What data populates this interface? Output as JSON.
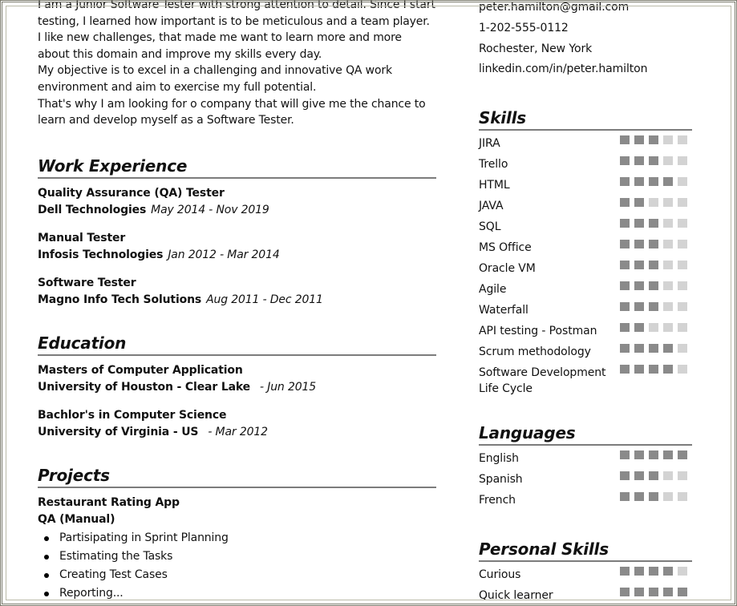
{
  "colors": {
    "filled": "#8a8a8a",
    "empty": "#d3d3d3",
    "rule": "#7c7c7c",
    "frame": "#7a7a6c"
  },
  "summary": [
    "I am a Junior Software Tester with strong attention to detail. Since I start testing, I learned how important is to be meticulous and a team player. I like new challenges, that made me want to learn more and more about this domain and improve my skills every day.",
    "My objective is to excel in a challenging and innovative QA work environment and aim to exercise my full potential.",
    "That's why I am looking for o company that will give me the chance to learn and develop myself as a Software Tester."
  ],
  "work": {
    "title": "Work Experience",
    "items": [
      {
        "role": "Quality Assurance (QA) Tester",
        "company": "Dell Technologies",
        "dates": "May 2014 - Nov 2019"
      },
      {
        "role": "Manual Tester",
        "company": "Infosis Technologies",
        "dates": "Jan 2012 - Mar 2014"
      },
      {
        "role": "Software Tester",
        "company": "Magno Info Tech Solutions",
        "dates": "Aug 2011 - Dec 2011"
      }
    ]
  },
  "education": {
    "title": "Education",
    "items": [
      {
        "degree": "Masters of Computer Application",
        "school": "University of Houston - Clear Lake",
        "dates": "- Jun 2015"
      },
      {
        "degree": "Bachlor's in Computer Science",
        "school": "University of Virginia - US",
        "dates": "- Mar 2012"
      }
    ]
  },
  "projects": {
    "title": "Projects",
    "items": [
      {
        "name": "Restaurant Rating App",
        "role": "QA (Manual)",
        "bullets": [
          "Partisipating in Sprint Planning",
          "Estimating the Tasks",
          "Creating Test Cases",
          "Reporting..."
        ]
      }
    ]
  },
  "contact": {
    "email": "peter.hamilton@gmail.com",
    "phone": "1-202-555-0112",
    "location": "Rochester, New York",
    "linkedin": "linkedin.com/in/peter.hamilton"
  },
  "skills": {
    "title": "Skills",
    "max": 5,
    "items": [
      {
        "name": "JIRA",
        "level": 3
      },
      {
        "name": "Trello",
        "level": 3
      },
      {
        "name": "HTML",
        "level": 4
      },
      {
        "name": "JAVA",
        "level": 2
      },
      {
        "name": "SQL",
        "level": 3
      },
      {
        "name": "MS Office",
        "level": 3
      },
      {
        "name": "Oracle VM",
        "level": 3
      },
      {
        "name": "Agile",
        "level": 3
      },
      {
        "name": "Waterfall",
        "level": 3
      },
      {
        "name": "API testing - Postman",
        "level": 2
      },
      {
        "name": "Scrum methodology",
        "level": 4
      },
      {
        "name": "Software Development Life Cycle",
        "level": 4
      }
    ]
  },
  "languages": {
    "title": "Languages",
    "max": 5,
    "items": [
      {
        "name": "English",
        "level": 5
      },
      {
        "name": "Spanish",
        "level": 3
      },
      {
        "name": "French",
        "level": 3
      }
    ]
  },
  "personal_skills": {
    "title": "Personal Skills",
    "max": 5,
    "items": [
      {
        "name": "Curious",
        "level": 4
      },
      {
        "name": "Quick learner",
        "level": 5
      }
    ]
  }
}
